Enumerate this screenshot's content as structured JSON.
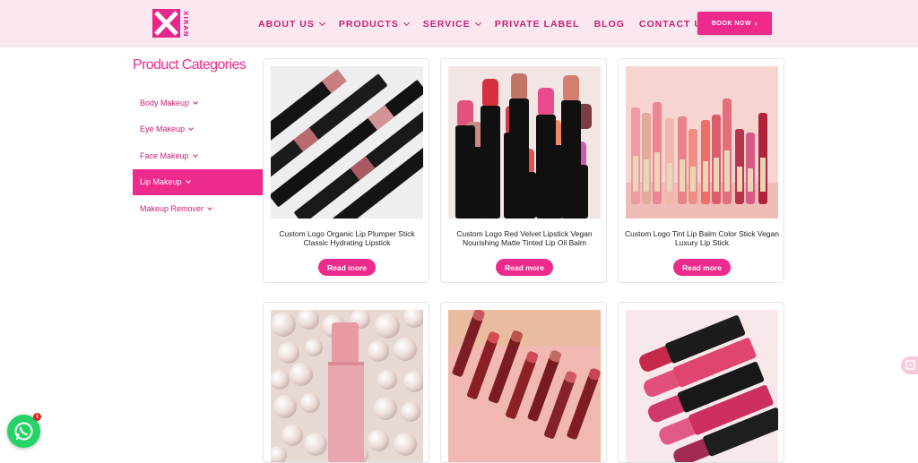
{
  "brand": {
    "name": "XIRAN",
    "color": "#e7278b"
  },
  "nav": {
    "items": [
      {
        "label": "ABOUT US",
        "has_dropdown": true
      },
      {
        "label": "PRODUCTS",
        "has_dropdown": true
      },
      {
        "label": "SERVICE",
        "has_dropdown": true
      },
      {
        "label": "PRIVATE LABEL",
        "has_dropdown": false
      },
      {
        "label": "BLOG",
        "has_dropdown": false
      },
      {
        "label": "CONTACT US",
        "has_dropdown": false
      }
    ],
    "cta": {
      "label": "BOOK NOW",
      "icon": "chevron-right-icon"
    }
  },
  "sidebar": {
    "title": "Product Categories",
    "items": [
      {
        "label": "Body Makeup",
        "active": false
      },
      {
        "label": "Eye Makeup",
        "active": false
      },
      {
        "label": "Face Makeup",
        "active": false
      },
      {
        "label": "Lip Makeup",
        "active": true
      },
      {
        "label": "Makeup Remover",
        "active": false
      }
    ]
  },
  "products": [
    {
      "name": "Custom Logo Organic Lip Plumper Stick Classic Hydrating Lipstick",
      "button": "Read more"
    },
    {
      "name": "Custom Logo Red Velvet Lipstick Vegan Nourishing Matte Tinted Lip Oil Balm",
      "button": "Read more"
    },
    {
      "name": "Custom Logo Tint Lip Balm Color Stick Vegan Luxury Lip Stick",
      "button": "Read more"
    },
    {
      "name": "",
      "button": ""
    },
    {
      "name": "",
      "button": ""
    },
    {
      "name": "",
      "button": ""
    }
  ],
  "floating": {
    "whatsapp_icon": "whatsapp-icon",
    "whatsapp_badge": "1"
  },
  "colors": {
    "accent": "#ee2a8c",
    "nav_text": "#c81f78",
    "header_bg": "#fbe7ef"
  }
}
